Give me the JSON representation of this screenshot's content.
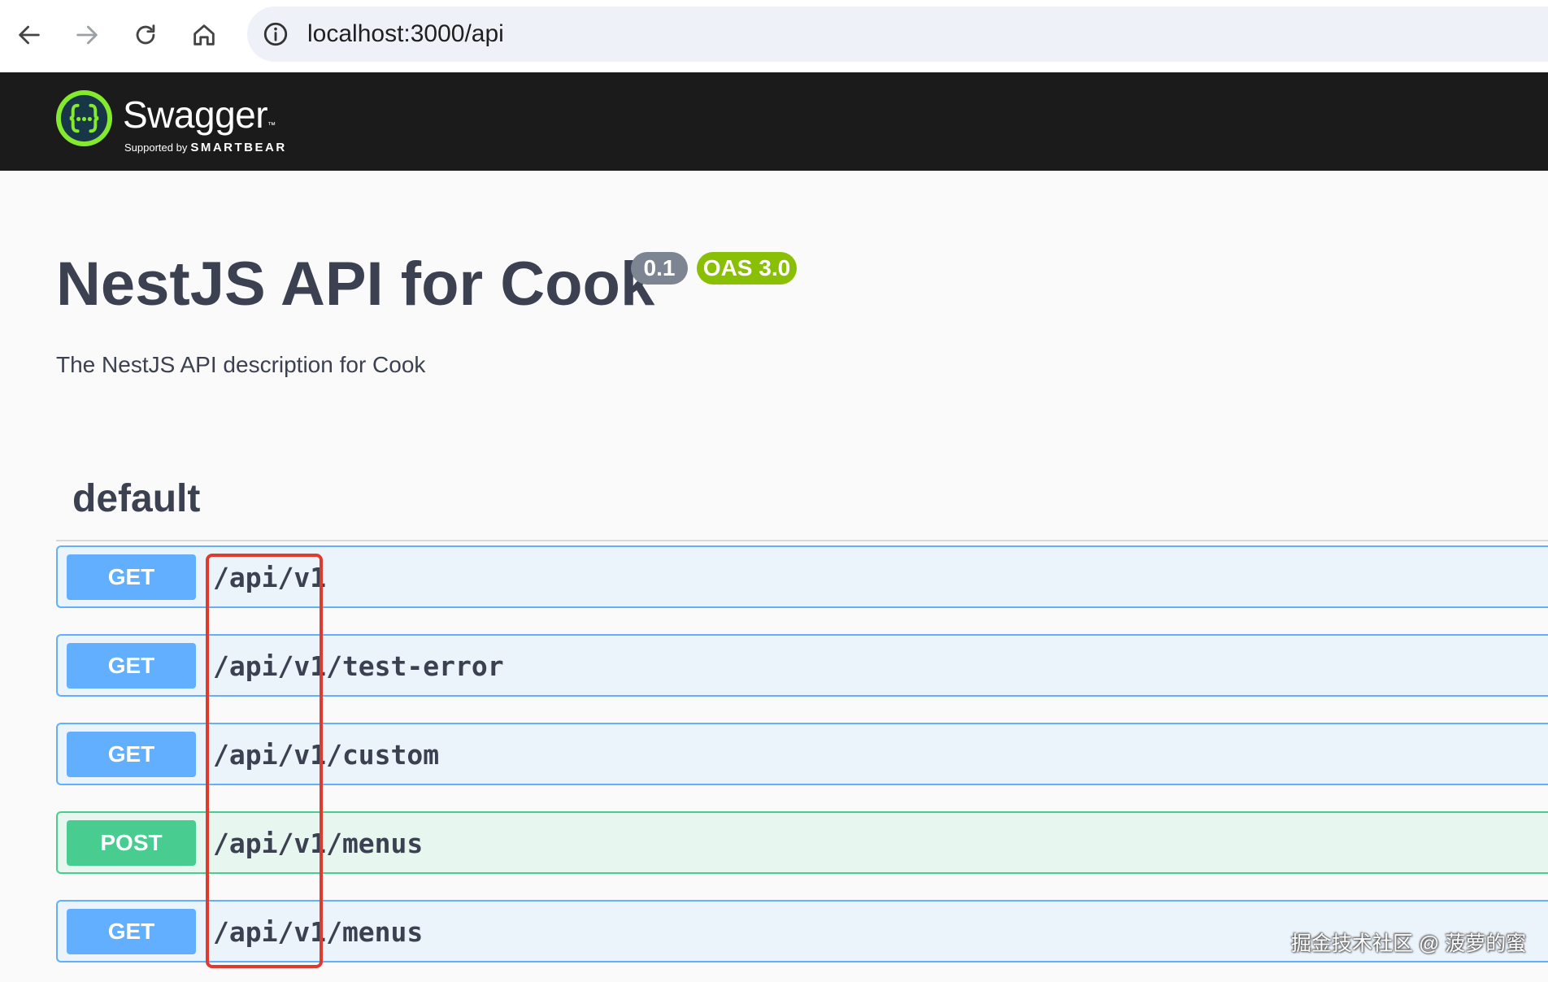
{
  "browser": {
    "url": "localhost:3000/api",
    "icons": [
      "back-arrow-icon",
      "forward-arrow-icon",
      "reload-icon",
      "home-icon",
      "site-info-icon"
    ]
  },
  "topbar": {
    "logo_word": "Swagger",
    "logo_tm": "™",
    "supported_by": "Supported by",
    "brand": "SMARTBEAR",
    "colors": {
      "background": "#1b1b1b",
      "logo_green": "#85ea2d"
    }
  },
  "info": {
    "title": "NestJS API for Cook",
    "version": "0.1",
    "oas": "OAS 3.0",
    "description": "The NestJS API description for Cook"
  },
  "tag": {
    "name": "default",
    "operations": [
      {
        "method": "GET",
        "path": "/api/v1"
      },
      {
        "method": "GET",
        "path": "/api/v1/test-error"
      },
      {
        "method": "GET",
        "path": "/api/v1/custom"
      },
      {
        "method": "POST",
        "path": "/api/v1/menus"
      },
      {
        "method": "GET",
        "path": "/api/v1/menus"
      }
    ]
  },
  "colors": {
    "get": "#61affe",
    "post": "#49cc90",
    "highlight": "#e03a2f"
  },
  "watermark": "掘金技术社区 @ 菠萝的蜜"
}
